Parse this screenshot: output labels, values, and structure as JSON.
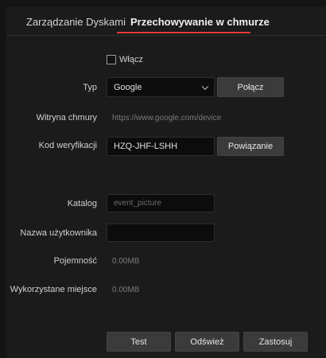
{
  "tabs": {
    "disk_management": "Zarządzanie Dyskami",
    "cloud_storage": "Przechowywanie w chmurze"
  },
  "enable": {
    "label": "Włącz",
    "checked": false
  },
  "type": {
    "label": "Typ",
    "selected": "Google",
    "connect_label": "Połącz"
  },
  "website": {
    "label": "Witryna chmury",
    "value": "https://www.google.com/device"
  },
  "verification": {
    "label": "Kod weryfikacji",
    "value": "HZQ-JHF-LSHH",
    "bind_label": "Powiązanie"
  },
  "directory": {
    "label": "Katalog",
    "placeholder": "event_picture"
  },
  "username": {
    "label": "Nazwa użytkownika",
    "value": ""
  },
  "capacity": {
    "label": "Pojemność",
    "value": "0.00MB"
  },
  "used": {
    "label": "Wykorzystane miejsce",
    "value": "0.00MB"
  },
  "actions": {
    "test": "Test",
    "refresh": "Odśwież",
    "apply": "Zastosuj"
  },
  "colors": {
    "accent": "#e53935",
    "background": "#1b1b1b"
  }
}
